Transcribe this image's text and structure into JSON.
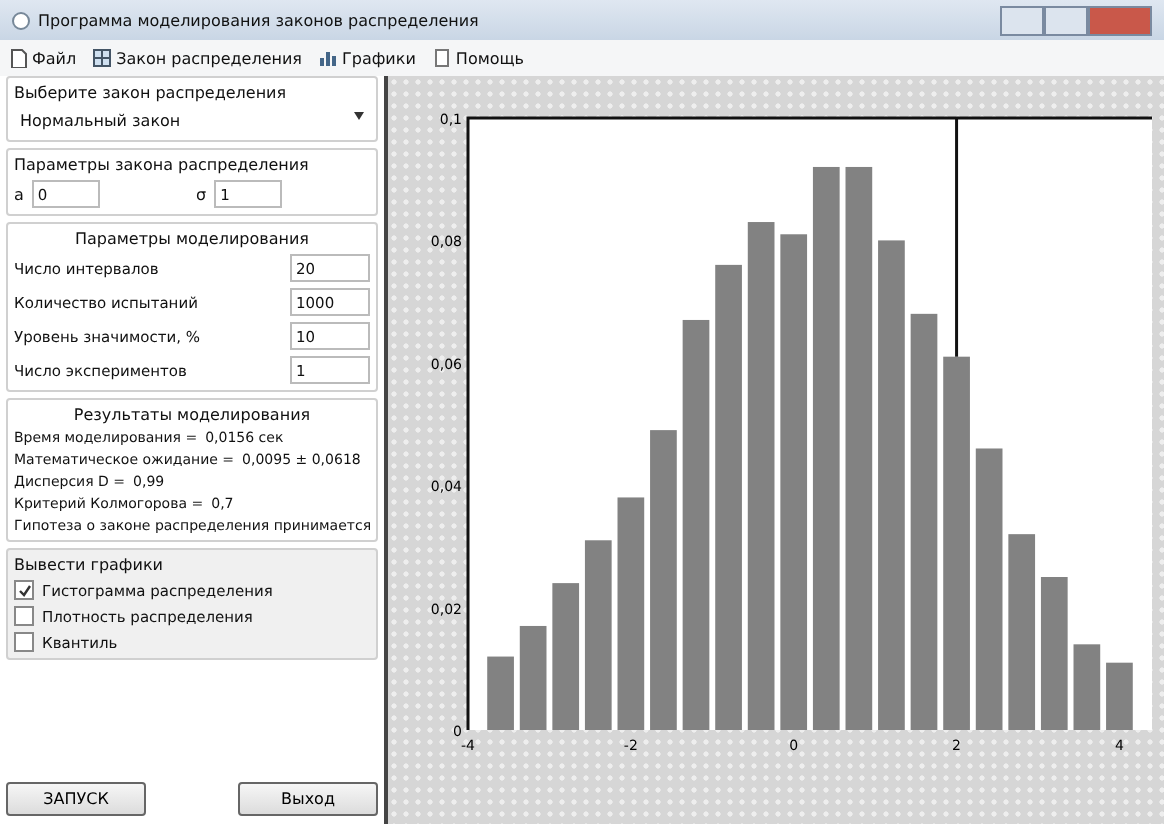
{
  "window": {
    "title": "Программа моделирования законов распределения"
  },
  "menu": [
    {
      "label": "Файл"
    },
    {
      "label": "Закон распределения"
    },
    {
      "label": "Графики"
    },
    {
      "label": "Помощь"
    }
  ],
  "law": {
    "heading": "Выберите закон распределения",
    "value": "Нормальный закон"
  },
  "law_params": {
    "heading": "Параметры закона распределения",
    "fields": [
      {
        "label": "a",
        "value": "0"
      },
      {
        "label": "σ",
        "value": "1"
      }
    ]
  },
  "modeling": {
    "heading": "Параметры моделирования",
    "fields": [
      {
        "label": "Число интервалов",
        "value": "20"
      },
      {
        "label": "Количество испытаний",
        "value": "1000"
      },
      {
        "label": "Уровень значимости, %",
        "value": "10"
      },
      {
        "label": "Число экспериментов",
        "value": "1"
      }
    ]
  },
  "results": {
    "heading": "Результаты моделирования",
    "lines": [
      {
        "label": "Время моделирования =",
        "value": "0,0156 сек"
      },
      {
        "label": "Математическое ожидание =",
        "value": "0,0095 ± 0,0618"
      },
      {
        "label": "Дисперсия D =",
        "value": "0,99"
      },
      {
        "label": "Критерий Колмогорова =",
        "value": "0,7"
      }
    ],
    "conclusion": "Гипотеза о законе распределения принимается"
  },
  "graphs": {
    "heading": "Вывести графики",
    "options": [
      {
        "label": "Гистограмма распределения",
        "checked": true
      },
      {
        "label": "Плотность распределения",
        "checked": false
      },
      {
        "label": "Квантиль",
        "checked": false
      }
    ]
  },
  "buttons": [
    "ЗАПУСК",
    "Выход"
  ],
  "chart_data": {
    "type": "bar",
    "x": [
      -3.6,
      -3.2,
      -2.8,
      -2.4,
      -2,
      -1.6,
      -1.2,
      -0.8,
      -0.4,
      0,
      0.4,
      0.8,
      1.2,
      1.6,
      2,
      2.4,
      2.8,
      3.2,
      3.6,
      4
    ],
    "values": [
      0.012,
      0.017,
      0.024,
      0.031,
      0.038,
      0.049,
      0.067,
      0.076,
      0.083,
      0.081,
      0.092,
      0.092,
      0.08,
      0.068,
      0.061,
      0.046,
      0.032,
      0.025,
      0.014,
      0.011
    ],
    "xlim": [
      -4,
      4.4
    ],
    "ylim": [
      0,
      0.1
    ],
    "xticks": [
      -4,
      -2,
      0,
      2,
      4
    ],
    "yticks": [
      {
        "value": 0,
        "label": "0"
      },
      {
        "value": 0.02,
        "label": "0,02"
      },
      {
        "value": 0.04,
        "label": "0,04"
      },
      {
        "value": 0.06,
        "label": "0,06"
      },
      {
        "value": 0.08,
        "label": "0,08"
      },
      {
        "value": 0.1,
        "label": "0,1"
      }
    ],
    "ref_lines": [
      {
        "axis": "x",
        "value": 2
      }
    ]
  }
}
